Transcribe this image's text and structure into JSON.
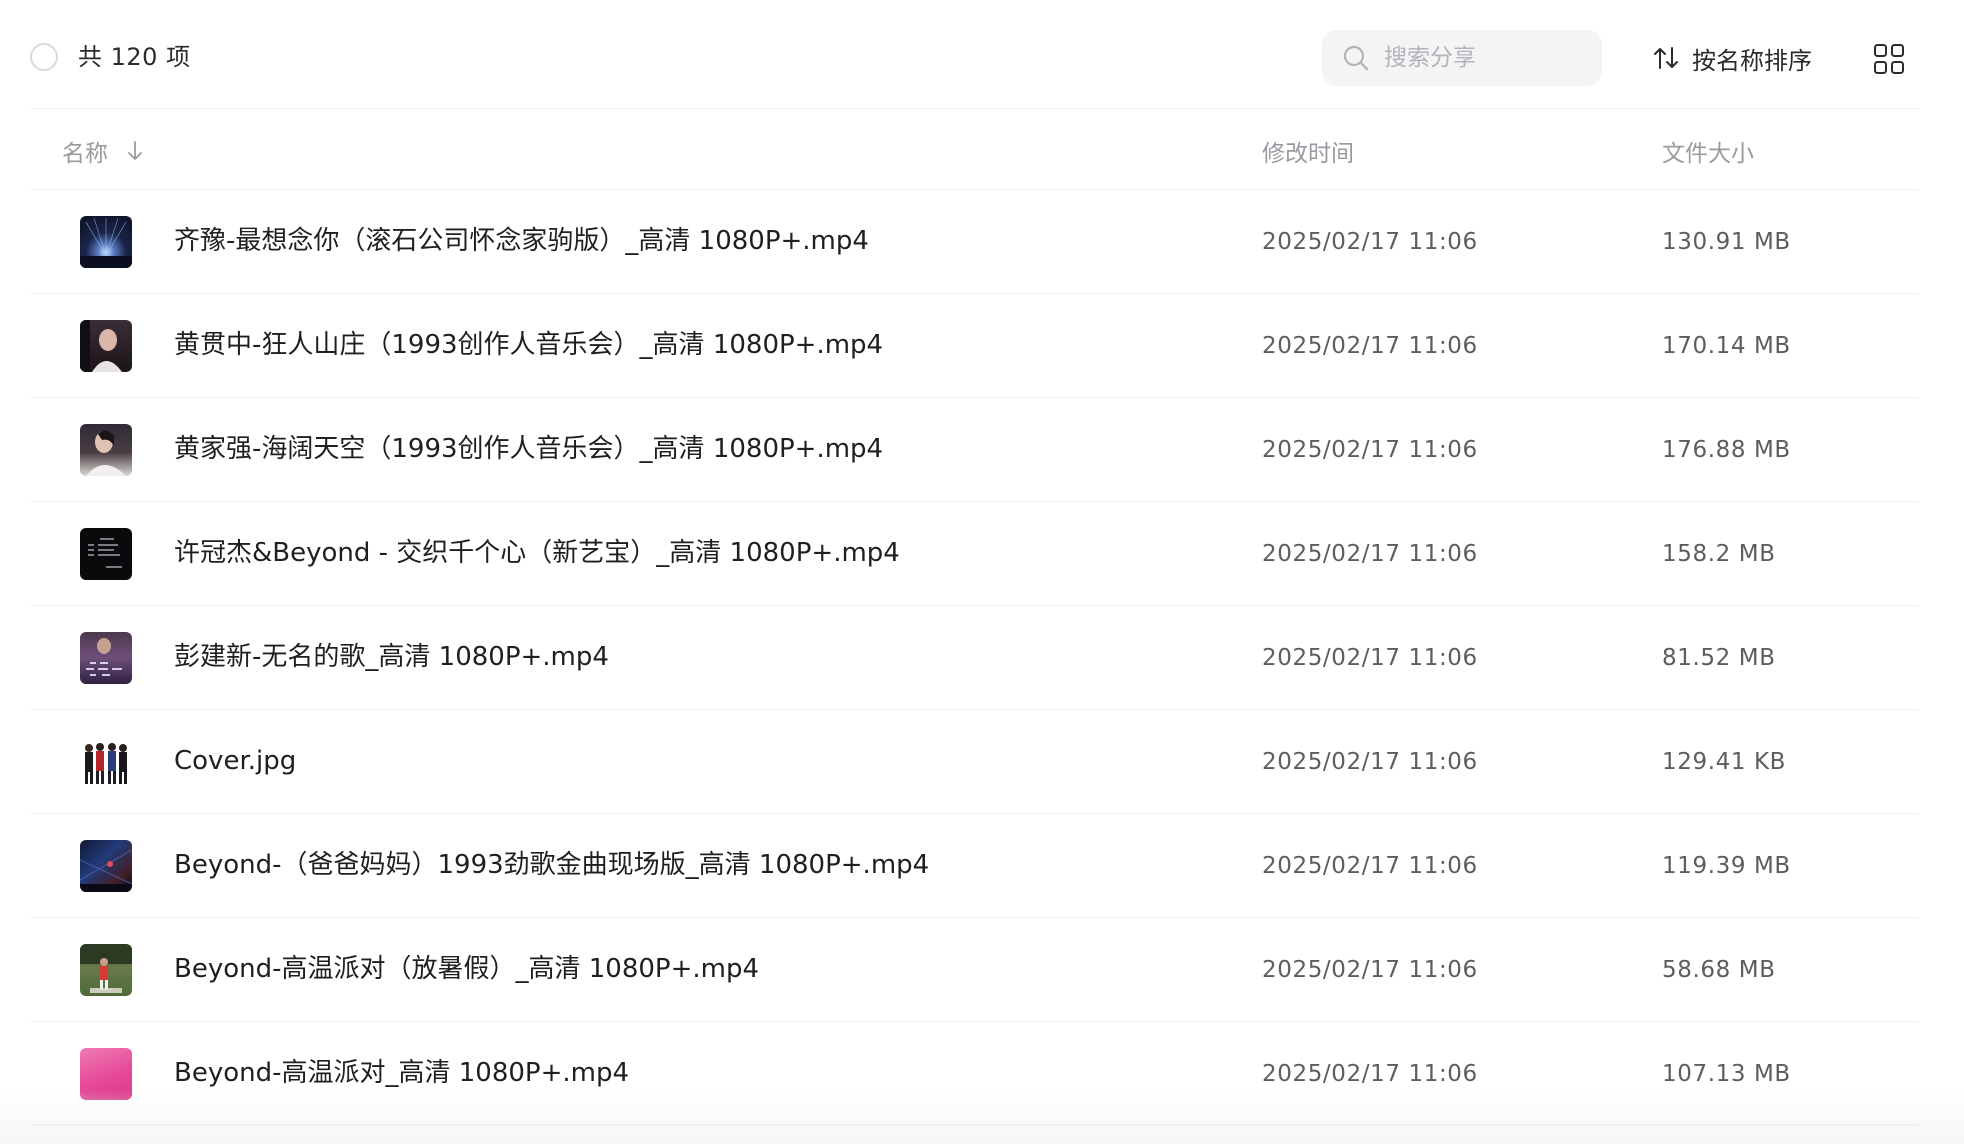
{
  "toolbar": {
    "item_count": "共 120 项",
    "search_placeholder": "搜索分享",
    "sort_label": "按名称排序"
  },
  "columns": {
    "name": "名称",
    "modified": "修改时间",
    "size": "文件大小"
  },
  "files": [
    {
      "name": "齐豫-最想念你（滚石公司怀念家驹版）_高清 1080P+.mp4",
      "modified": "2025/02/17 11:06",
      "size": "130.91 MB",
      "type": "video"
    },
    {
      "name": "黄贯中-狂人山庄（1993创作人音乐会）_高清 1080P+.mp4",
      "modified": "2025/02/17 11:06",
      "size": "170.14 MB",
      "type": "video"
    },
    {
      "name": "黄家强-海阔天空（1993创作人音乐会）_高清 1080P+.mp4",
      "modified": "2025/02/17 11:06",
      "size": "176.88 MB",
      "type": "video"
    },
    {
      "name": "许冠杰&Beyond - 交织千个心（新艺宝）_高清 1080P+.mp4",
      "modified": "2025/02/17 11:06",
      "size": "158.2 MB",
      "type": "video"
    },
    {
      "name": "彭建新-无名的歌_高清 1080P+.mp4",
      "modified": "2025/02/17 11:06",
      "size": "81.52 MB",
      "type": "video"
    },
    {
      "name": "Cover.jpg",
      "modified": "2025/02/17 11:06",
      "size": "129.41 KB",
      "type": "image"
    },
    {
      "name": "Beyond-（爸爸妈妈）1993劲歌金曲现场版_高清 1080P+.mp4",
      "modified": "2025/02/17 11:06",
      "size": "119.39 MB",
      "type": "video"
    },
    {
      "name": "Beyond-高温派对（放暑假）_高清 1080P+.mp4",
      "modified": "2025/02/17 11:06",
      "size": "58.68 MB",
      "type": "video"
    },
    {
      "name": "Beyond-高温派对_高清 1080P+.mp4",
      "modified": "2025/02/17 11:06",
      "size": "107.13 MB",
      "type": "video"
    }
  ],
  "colors": {
    "text_primary": "#1f1f1f",
    "text_secondary": "#5c5c62",
    "text_muted": "#9a9aa0",
    "divider": "#eeeef0",
    "search_bg": "#f4f4f6"
  },
  "icons": {
    "select_all": "circle-checkbox-icon",
    "search": "search-icon",
    "sort": "sort-arrows-icon",
    "view_toggle": "grid-view-icon",
    "column_sort": "arrow-down-icon"
  }
}
